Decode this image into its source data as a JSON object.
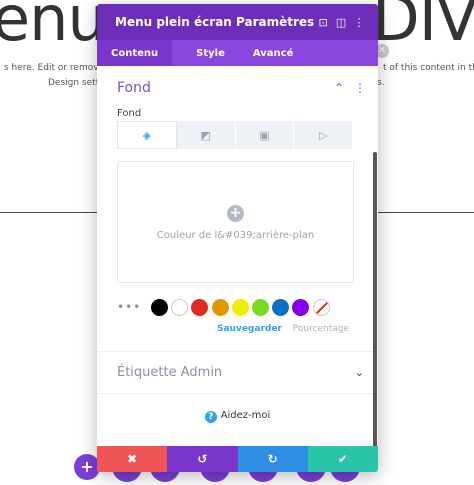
{
  "background": {
    "heading_left": "enu",
    "heading_right": "DIVI",
    "text_line1_left": "s here. Edit or remove this",
    "text_line2_left": "Design settin",
    "text_line1_right": "t of this content in the m",
    "text_line2_right": "s."
  },
  "modal": {
    "title": "Menu plein écran Paramètres",
    "header_icons": [
      "focus-icon",
      "columns-icon",
      "more-vertical-icon"
    ],
    "tabs": [
      {
        "label": "Contenu",
        "active": true
      },
      {
        "label": "Style",
        "active": false
      },
      {
        "label": "Avancé",
        "active": false
      }
    ]
  },
  "section": {
    "title": "Fond",
    "field_label": "Fond",
    "bg_tabs": [
      {
        "name": "color-tab",
        "icon": "paint-bucket-icon",
        "active": true
      },
      {
        "name": "gradient-tab",
        "icon": "gradient-icon",
        "active": false
      },
      {
        "name": "image-tab",
        "icon": "image-icon",
        "active": false
      },
      {
        "name": "video-tab",
        "icon": "video-icon",
        "active": false
      }
    ],
    "color_placeholder": "Couleur de l&#039;arrière-plan"
  },
  "swatches": {
    "colors": [
      "#000000",
      "#ffffff",
      "#e02b20",
      "#e09900",
      "#edf000",
      "#7cda24",
      "#0c71c3",
      "#8300e9"
    ],
    "save_label": "Sauvegarder",
    "percent_label": "Pourcentage"
  },
  "admin": {
    "title": "Étiquette Admin"
  },
  "help": {
    "label": "Aidez-moi"
  },
  "footer": {
    "buttons": [
      {
        "name": "cancel-button",
        "icon": "✖",
        "color": "#ef5555"
      },
      {
        "name": "undo-button",
        "icon": "↺",
        "color": "#7a35cc"
      },
      {
        "name": "redo-button",
        "icon": "↻",
        "color": "#2e8ee4"
      },
      {
        "name": "save-button",
        "icon": "✔",
        "color": "#29c4a9"
      }
    ]
  }
}
